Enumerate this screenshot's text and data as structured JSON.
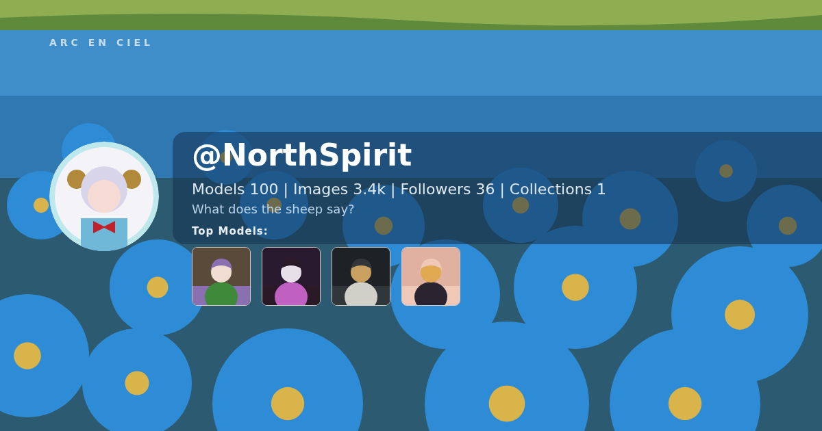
{
  "brand": "ARC EN CIEL",
  "profile": {
    "handle": "@NorthSpirit",
    "stats": "Models 100 | Images 3.4k | Followers 36 | Collections 1",
    "tagline": "What does the sheep say?"
  },
  "top_models": {
    "label": "Top Models:"
  }
}
